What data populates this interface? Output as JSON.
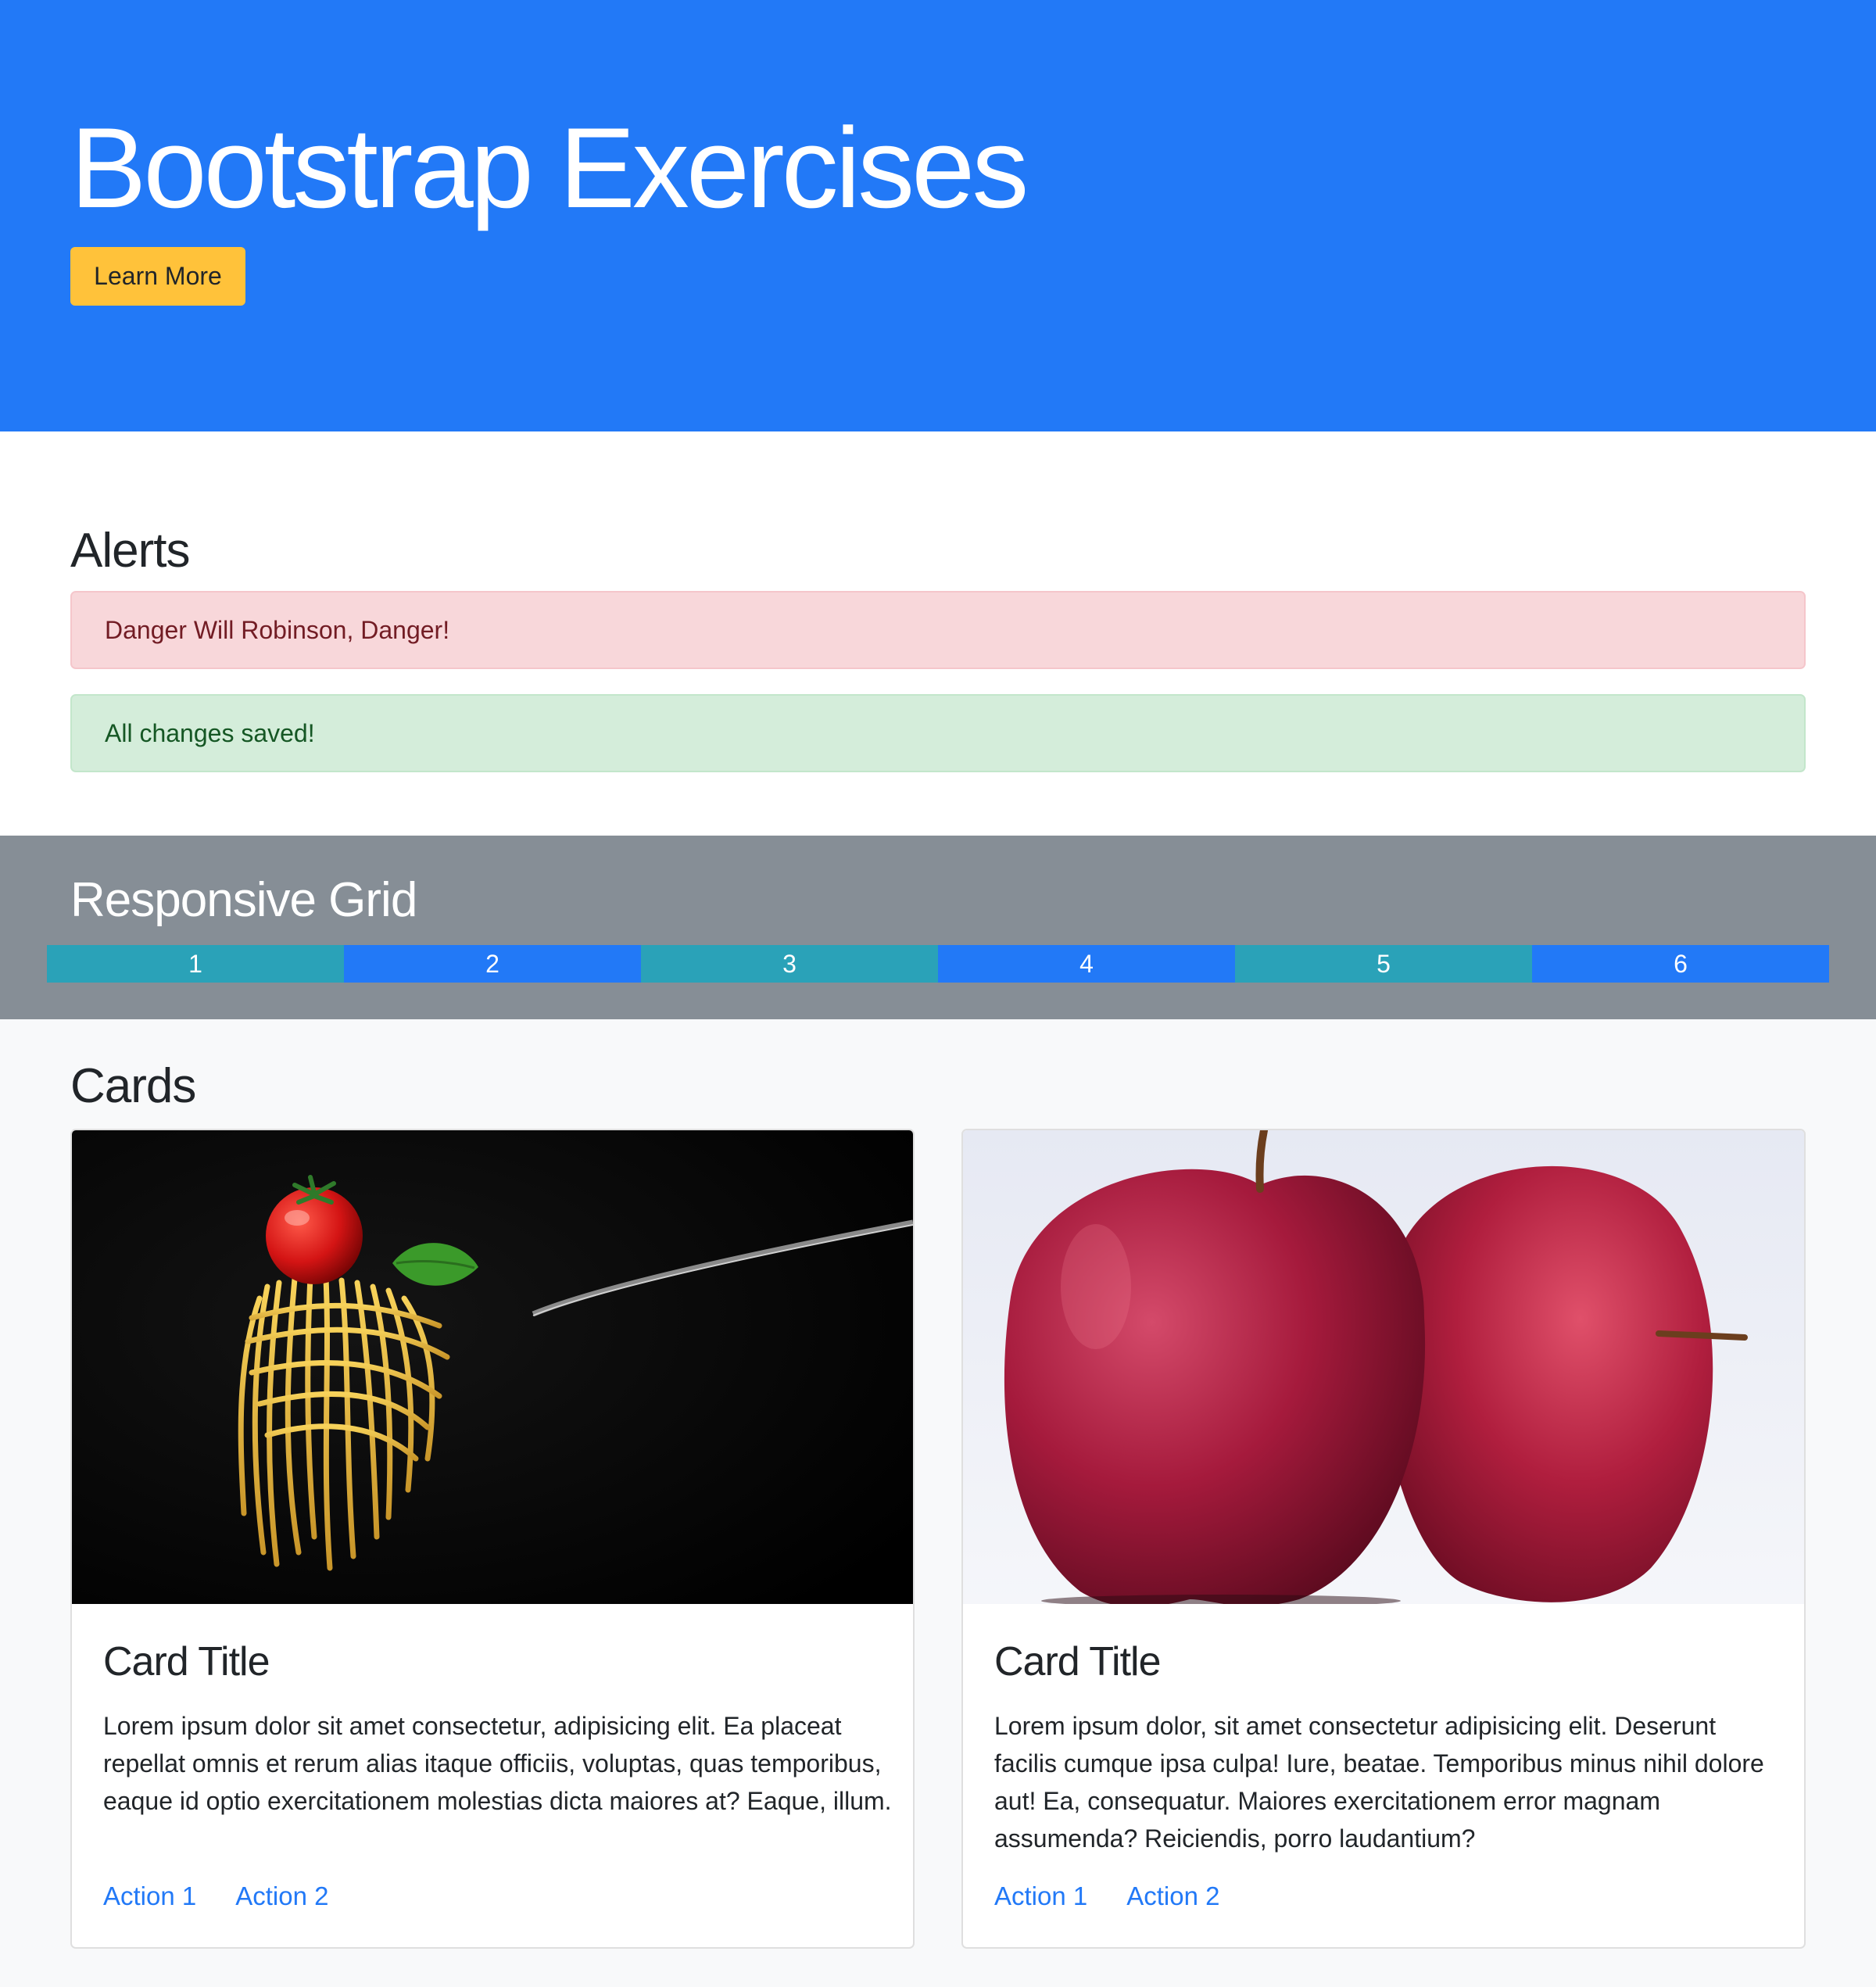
{
  "jumbotron": {
    "title": "Bootstrap Exercises",
    "button_label": "Learn More"
  },
  "alerts": {
    "heading": "Alerts",
    "items": [
      {
        "text": "Danger Will Robinson, Danger!",
        "variant": "danger"
      },
      {
        "text": "All changes saved!",
        "variant": "success"
      }
    ]
  },
  "grid": {
    "heading": "Responsive Grid",
    "columns": [
      {
        "label": "1",
        "color": "#2aa2b8"
      },
      {
        "label": "2",
        "color": "#2279f7"
      },
      {
        "label": "3",
        "color": "#2aa2b8"
      },
      {
        "label": "4",
        "color": "#2279f7"
      },
      {
        "label": "5",
        "color": "#2aa2b8"
      },
      {
        "label": "6",
        "color": "#2279f7"
      }
    ]
  },
  "cards": {
    "heading": "Cards",
    "items": [
      {
        "image": "spaghetti-on-fork-photo",
        "title": "Card Title",
        "text": "Lorem ipsum dolor sit amet consectetur, adipisicing elit. Ea placeat repellat omnis et rerum alias itaque officiis, voluptas, quas temporibus, eaque id optio exercitationem molestias dicta maiores at? Eaque, illum.",
        "actions": [
          "Action 1",
          "Action 2"
        ]
      },
      {
        "image": "red-apples-photo",
        "title": "Card Title",
        "text": "Lorem ipsum dolor, sit amet consectetur adipisicing elit. Deserunt facilis cumque ipsa culpa! Iure, beatae. Temporibus minus nihil dolore aut! Ea, consequatur. Maiores exercitationem error magnam assumenda? Reiciendis, porro laudantium?",
        "actions": [
          "Action 1",
          "Action 2"
        ]
      }
    ]
  },
  "colors": {
    "primary": "#2279f7",
    "warning": "#ffc23a",
    "info": "#2aa2b8",
    "secondary": "#868e96",
    "danger_bg": "#f8d7da",
    "success_bg": "#d4edda"
  }
}
